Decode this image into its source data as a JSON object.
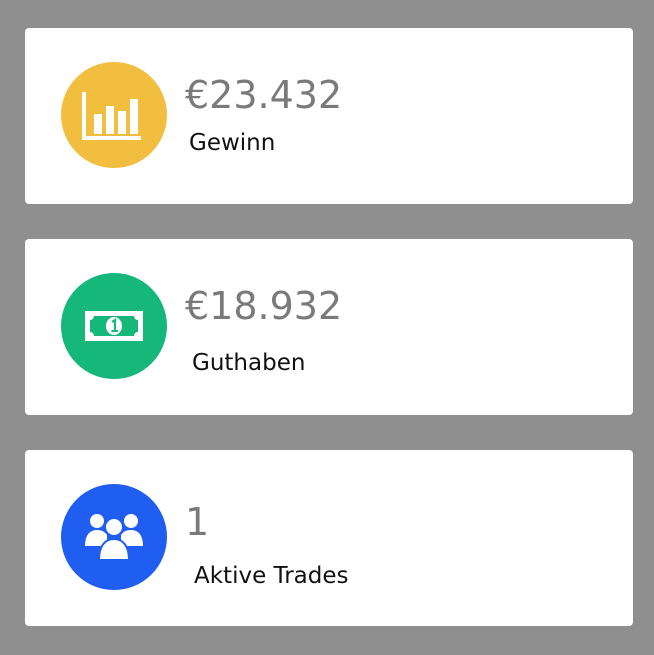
{
  "stats": [
    {
      "value": "€23.432",
      "label": "Gewinn",
      "icon": "bar-chart-icon",
      "color": "#f2be3f"
    },
    {
      "value": "€18.932",
      "label": "Guthaben",
      "icon": "banknote-icon",
      "color": "#16b77a"
    },
    {
      "value": "1",
      "label": "Aktive Trades",
      "icon": "users-icon",
      "color": "#1f5ef0"
    }
  ]
}
